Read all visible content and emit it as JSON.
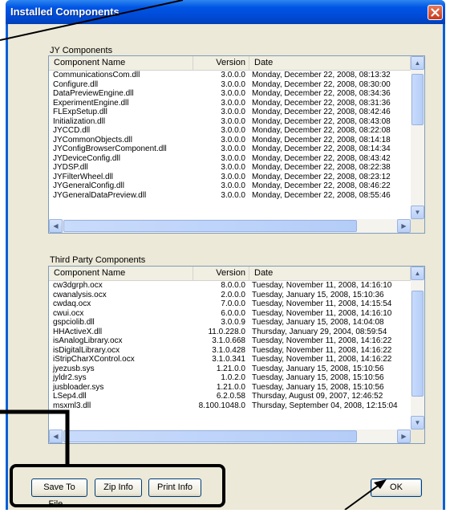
{
  "window": {
    "title": "Installed Components"
  },
  "jy": {
    "group_label": "JY Components",
    "columns": [
      "Component Name",
      "Version",
      "Date"
    ],
    "rows": [
      [
        "CommunicationsCom.dll",
        "3.0.0.0",
        "Monday, December 22, 2008, 08:13:32"
      ],
      [
        "Configure.dll",
        "3.0.0.0",
        "Monday, December 22, 2008, 08:30:00"
      ],
      [
        "DataPreviewEngine.dll",
        "3.0.0.0",
        "Monday, December 22, 2008, 08:34:36"
      ],
      [
        "ExperimentEngine.dll",
        "3.0.0.0",
        "Monday, December 22, 2008, 08:31:36"
      ],
      [
        "FLExpSetup.dll",
        "3.0.0.0",
        "Monday, December 22, 2008, 08:42:46"
      ],
      [
        "Initialization.dll",
        "3.0.0.0",
        "Monday, December 22, 2008, 08:43:08"
      ],
      [
        "JYCCD.dll",
        "3.0.0.0",
        "Monday, December 22, 2008, 08:22:08"
      ],
      [
        "JYCommonObjects.dll",
        "3.0.0.0",
        "Monday, December 22, 2008, 08:14:18"
      ],
      [
        "JYConfigBrowserComponent.dll",
        "3.0.0.0",
        "Monday, December 22, 2008, 08:14:34"
      ],
      [
        "JYDeviceConfig.dll",
        "3.0.0.0",
        "Monday, December 22, 2008, 08:43:42"
      ],
      [
        "JYDSP.dll",
        "3.0.0.0",
        "Monday, December 22, 2008, 08:22:38"
      ],
      [
        "JYFilterWheel.dll",
        "3.0.0.0",
        "Monday, December 22, 2008, 08:23:12"
      ],
      [
        "JYGeneralConfig.dll",
        "3.0.0.0",
        "Monday, December 22, 2008, 08:46:22"
      ],
      [
        "JYGeneralDataPreview.dll",
        "3.0.0.0",
        "Monday, December 22, 2008, 08:55:46"
      ]
    ]
  },
  "third_party": {
    "group_label": "Third Party Components",
    "columns": [
      "Component Name",
      "Version",
      "Date"
    ],
    "rows": [
      [
        "cw3dgrph.ocx",
        "8.0.0.0",
        "Tuesday, November 11, 2008, 14:16:10"
      ],
      [
        "cwanalysis.ocx",
        "2.0.0.0",
        "Tuesday, January 15, 2008, 15:10:36"
      ],
      [
        "cwdaq.ocx",
        "7.0.0.0",
        "Tuesday, November 11, 2008, 14:15:54"
      ],
      [
        "cwui.ocx",
        "6.0.0.0",
        "Tuesday, November 11, 2008, 14:16:10"
      ],
      [
        "gspciolib.dll",
        "3.0.0.9",
        "Tuesday, January 15, 2008, 14:04:08"
      ],
      [
        "HHActiveX.dll",
        "11.0.228.0",
        "Thursday, January 29, 2004, 08:59:54"
      ],
      [
        "isAnalogLibrary.ocx",
        "3.1.0.668",
        "Tuesday, November 11, 2008, 14:16:22"
      ],
      [
        "isDigitalLibrary.ocx",
        "3.1.0.428",
        "Tuesday, November 11, 2008, 14:16:22"
      ],
      [
        "iStripCharXControl.ocx",
        "3.1.0.341",
        "Tuesday, November 11, 2008, 14:16:22"
      ],
      [
        "jyezusb.sys",
        "1.21.0.0",
        "Tuesday, January 15, 2008, 15:10:56"
      ],
      [
        "jyldr2.sys",
        "1.0.2.0",
        "Tuesday, January 15, 2008, 15:10:56"
      ],
      [
        "jusbloader.sys",
        "1.21.0.0",
        "Tuesday, January 15, 2008, 15:10:56"
      ],
      [
        "LSep4.dll",
        "6.2.0.58",
        "Thursday, August 09, 2007, 12:46:52"
      ],
      [
        "msxml3.dll",
        "8.100.1048.0",
        "Thursday, September 04, 2008, 12:15:04"
      ]
    ]
  },
  "buttons": {
    "save": "Save To File...",
    "zip": "Zip Info",
    "print": "Print Info",
    "ok": "OK"
  },
  "icons": {
    "close": "close-icon",
    "up": "scroll-up-arrow-icon",
    "down": "scroll-down-arrow-icon",
    "left": "scroll-left-arrow-icon",
    "right": "scroll-right-arrow-icon"
  },
  "colors": {
    "title_bar": "#0055e5",
    "dialog_bg": "#ece9d8",
    "close_button": "#c7391c"
  }
}
